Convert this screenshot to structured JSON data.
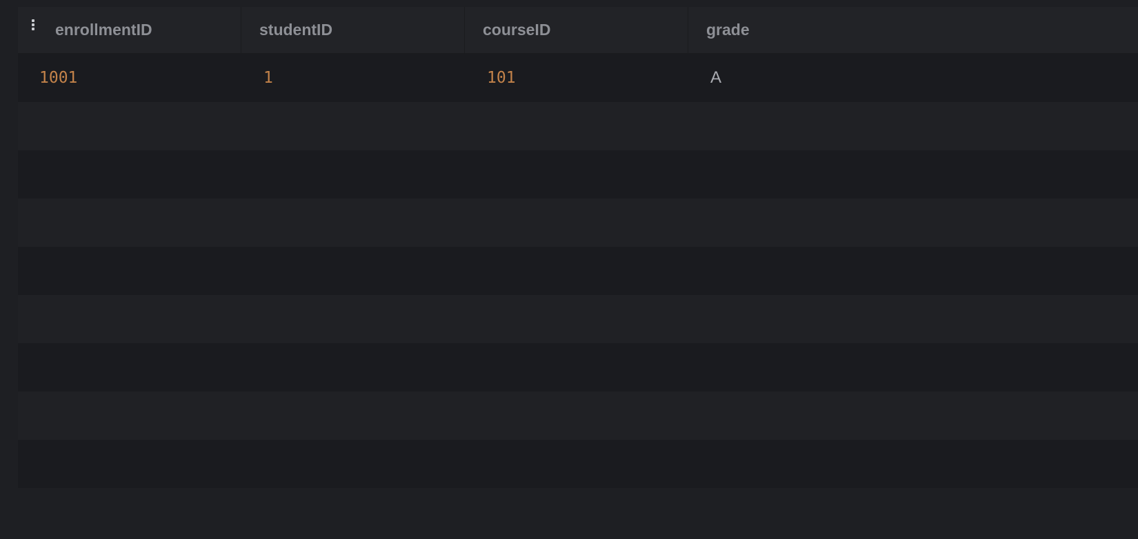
{
  "table": {
    "columns": [
      "enrollmentID",
      "studentID",
      "courseID",
      "grade"
    ],
    "rows": [
      [
        "1001",
        "1",
        "101",
        "A"
      ]
    ]
  },
  "icons": {
    "column_menu": "more-vertical-icon"
  },
  "colors": {
    "background": "#1e1f23",
    "header_text": "#8e9096",
    "number_value": "#c4834a",
    "text_value": "#a9abb1"
  }
}
